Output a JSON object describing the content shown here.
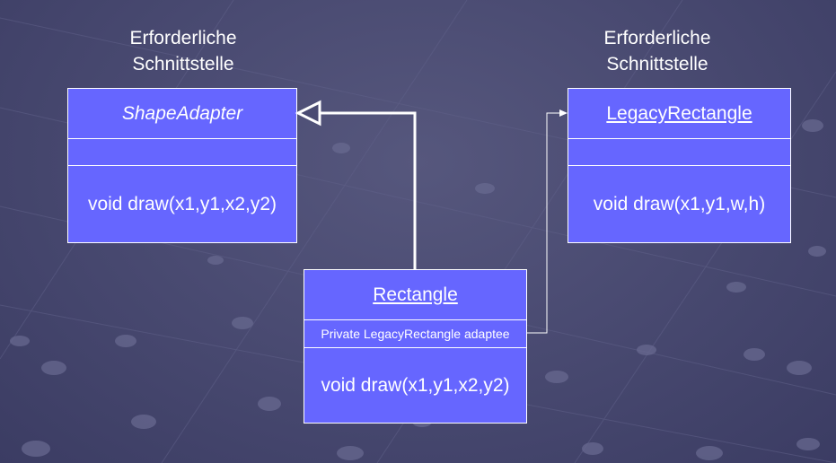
{
  "captions": {
    "left": [
      "Erforderliche",
      "Schnittstelle"
    ],
    "right": [
      "Erforderliche",
      "Schnittstelle"
    ]
  },
  "classes": {
    "shape_adapter": {
      "name": "ShapeAdapter",
      "attributes": "",
      "method": "void draw(x1,y1,x2,y2)"
    },
    "legacy_rectangle": {
      "name": "LegacyRectangle",
      "attributes": "",
      "method": "void draw(x1,y1,w,h)"
    },
    "rectangle": {
      "name": "Rectangle",
      "attributes": "Private LegacyRectangle adaptee",
      "method": "void draw(x1,y1,x2,y2)"
    }
  },
  "colors": {
    "class_fill": "#6666ff",
    "border": "#ffffff",
    "text": "#ffffff"
  }
}
